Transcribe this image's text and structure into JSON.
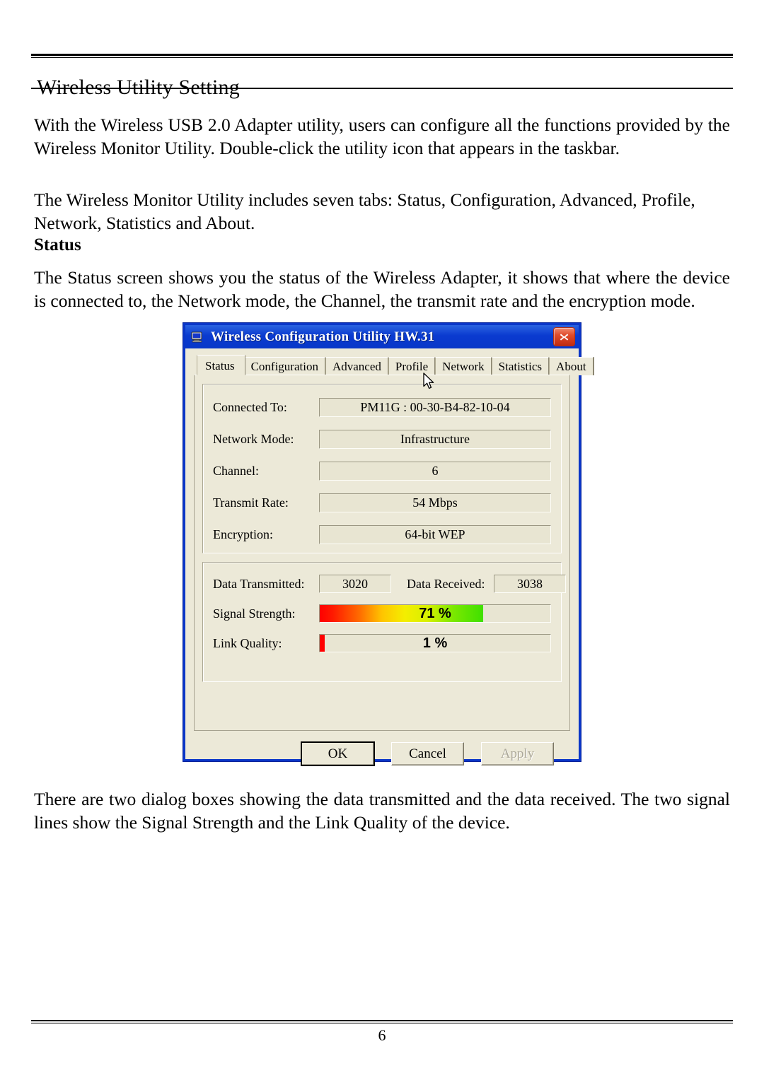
{
  "document": {
    "title": "Wireless Utility Setting",
    "paragraph_1": "With the Wireless USB 2.0 Adapter utility, users can configure all the functions provided by the Wireless Monitor Utility. Double-click the utility icon that appears in the taskbar.",
    "paragraph_2": "The Wireless Monitor Utility includes seven tabs: Status, Configuration, Advanced, Profile, Network, Statistics and About.",
    "section_heading": "Status",
    "paragraph_3": "The Status screen shows you the status of the Wireless Adapter, it shows that where the device is connected to, the Network mode, the Channel, the transmit rate and the encryption mode.",
    "paragraph_4": "There are two dialog boxes showing the data transmitted and the data received. The two signal lines show the Signal Strength and the Link Quality of the device.",
    "page_number": "6"
  },
  "dialog": {
    "title": "Wireless Configuration Utility HW.31",
    "titlebar_icon": "computer-icon",
    "close_icon": "close-icon",
    "accent_color": "#0a3ad0",
    "face_color": "#ece9d8",
    "tabs": [
      {
        "label": "Status",
        "active": true
      },
      {
        "label": "Configuration",
        "active": false
      },
      {
        "label": "Advanced",
        "active": false
      },
      {
        "label": "Profile",
        "active": false
      },
      {
        "label": "Network",
        "active": false
      },
      {
        "label": "Statistics",
        "active": false
      },
      {
        "label": "About",
        "active": false
      }
    ],
    "status_fields": [
      {
        "label": "Connected To:",
        "value": "PM11G : 00-30-B4-82-10-04"
      },
      {
        "label": "Network Mode:",
        "value": "Infrastructure"
      },
      {
        "label": "Channel:",
        "value": "6"
      },
      {
        "label": "Transmit Rate:",
        "value": "54 Mbps"
      },
      {
        "label": "Encryption:",
        "value": "64-bit WEP"
      }
    ],
    "counters": {
      "transmitted_label": "Data Transmitted:",
      "transmitted_value": "3020",
      "received_label": "Data Received:",
      "received_value": "3038"
    },
    "meters": [
      {
        "label": "Signal Strength:",
        "text": "71 %",
        "percent": 71,
        "style": "signal",
        "colors": [
          "#ff0000",
          "#ffc400",
          "#f4ee00",
          "#3fe000"
        ]
      },
      {
        "label": "Link Quality:",
        "text": "1 %",
        "percent": 2,
        "style": "quality",
        "colors": [
          "#ff0000"
        ]
      }
    ],
    "buttons": [
      {
        "label": "OK",
        "state": "default"
      },
      {
        "label": "Cancel",
        "state": "normal"
      },
      {
        "label": "Apply",
        "state": "disabled"
      }
    ]
  }
}
